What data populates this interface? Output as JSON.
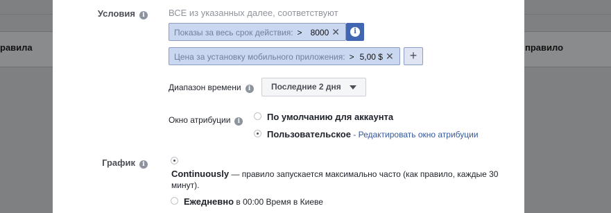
{
  "background": {
    "left_header": "равила",
    "right_header": "правило"
  },
  "conditions": {
    "label": "Условия",
    "header": "ВСЕ из указанных далее, соответствуют",
    "rules": [
      {
        "field": "Показы за весь срок действия:",
        "operator": ">",
        "value": "8000"
      },
      {
        "field": "Цена за установку мобильного приложения:",
        "operator": ">",
        "value": "5,00 $"
      }
    ],
    "add_label": "+"
  },
  "time_range": {
    "label": "Диапазон времени",
    "selected": "Последние 2 дня"
  },
  "attribution": {
    "label": "Окно атрибуции",
    "options": [
      {
        "label": "По умолчанию для аккаунта",
        "selected": false
      },
      {
        "label": "Пользовательское",
        "separator": " - ",
        "link": "Редактировать окно атрибуции",
        "selected": true
      }
    ]
  },
  "schedule": {
    "label": "График",
    "continuous_title": "Continuously",
    "continuous_desc_line1": " — правило запускается максимально часто (как правило, каждые 30",
    "continuous_desc_line2": "минут).",
    "daily_title": "Ежедневно",
    "daily_desc": " в 00:00 Время в Киеве",
    "continuous_selected": true
  },
  "icons": {
    "info": "info-icon",
    "close": "close-icon",
    "caret": "caret-down-icon",
    "plus": "plus-icon"
  }
}
